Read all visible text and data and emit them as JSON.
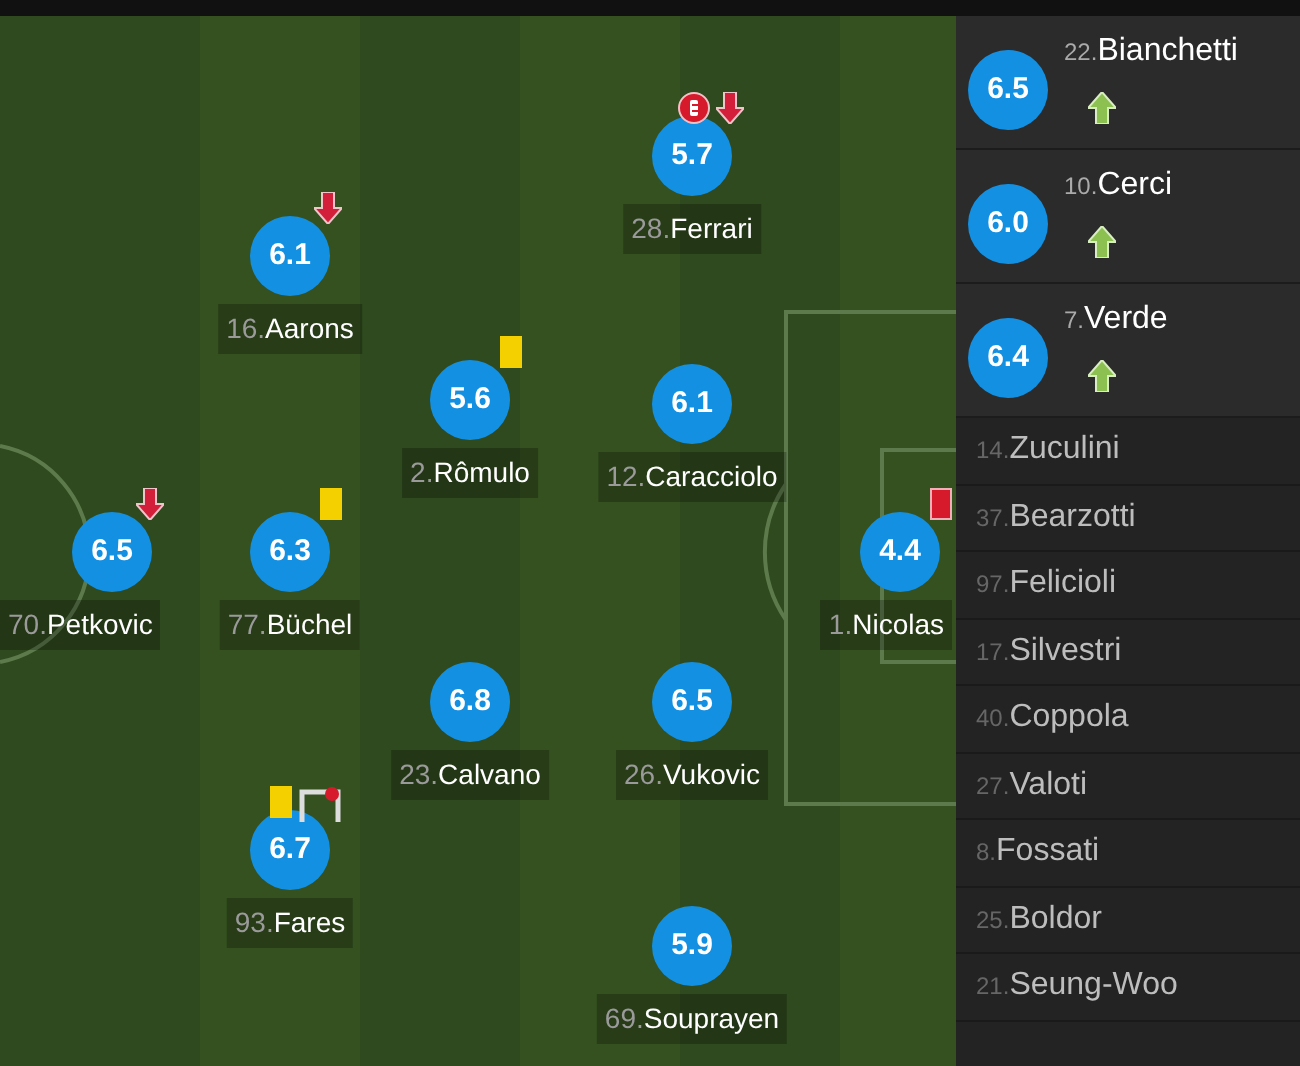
{
  "starters": [
    {
      "number": "28.",
      "name": "Ferrari",
      "rating": "5.7",
      "events": [
        {
          "kind": "error"
        },
        {
          "kind": "sub_off"
        }
      ]
    },
    {
      "number": "16.",
      "name": "Aarons",
      "rating": "6.1",
      "events": [
        {
          "kind": "sub_off"
        }
      ]
    },
    {
      "number": "2.",
      "name": "Rômulo",
      "rating": "5.6",
      "events": [
        {
          "kind": "yellow_card"
        }
      ]
    },
    {
      "number": "12.",
      "name": "Caracciolo",
      "rating": "6.1"
    },
    {
      "number": "70.",
      "name": "Petkovic",
      "rating": "6.5",
      "events": [
        {
          "kind": "sub_off"
        }
      ]
    },
    {
      "number": "77.",
      "name": "Büchel",
      "rating": "6.3",
      "events": [
        {
          "kind": "yellow_card"
        }
      ]
    },
    {
      "number": "1.",
      "name": "Nicolas",
      "rating": "4.4",
      "events": [
        {
          "kind": "red_card"
        }
      ]
    },
    {
      "number": "23.",
      "name": "Calvano",
      "rating": "6.8"
    },
    {
      "number": "26.",
      "name": "Vukovic",
      "rating": "6.5"
    },
    {
      "number": "93.",
      "name": "Fares",
      "rating": "6.7",
      "events": [
        {
          "kind": "yellow_card"
        },
        {
          "kind": "goal"
        }
      ]
    },
    {
      "number": "69.",
      "name": "Souprayen",
      "rating": "5.9"
    }
  ],
  "substitutes": [
    {
      "number": "22.",
      "name": "Bianchetti",
      "rating": "6.5",
      "events": [
        {
          "kind": "sub_on"
        }
      ]
    },
    {
      "number": "10.",
      "name": "Cerci",
      "rating": "6.0",
      "events": [
        {
          "kind": "sub_on"
        }
      ]
    },
    {
      "number": "7.",
      "name": "Verde",
      "rating": "6.4",
      "events": [
        {
          "kind": "sub_on"
        }
      ]
    }
  ],
  "unused": [
    {
      "number": "14.",
      "name": "Zuculini"
    },
    {
      "number": "37.",
      "name": "Bearzotti"
    },
    {
      "number": "97.",
      "name": "Felicioli"
    },
    {
      "number": "17.",
      "name": "Silvestri"
    },
    {
      "number": "40.",
      "name": "Coppola"
    },
    {
      "number": "27.",
      "name": "Valoti"
    },
    {
      "number": "8.",
      "name": "Fossati"
    },
    {
      "number": "25.",
      "name": "Boldor"
    },
    {
      "number": "21.",
      "name": "Seung-Woo"
    }
  ]
}
